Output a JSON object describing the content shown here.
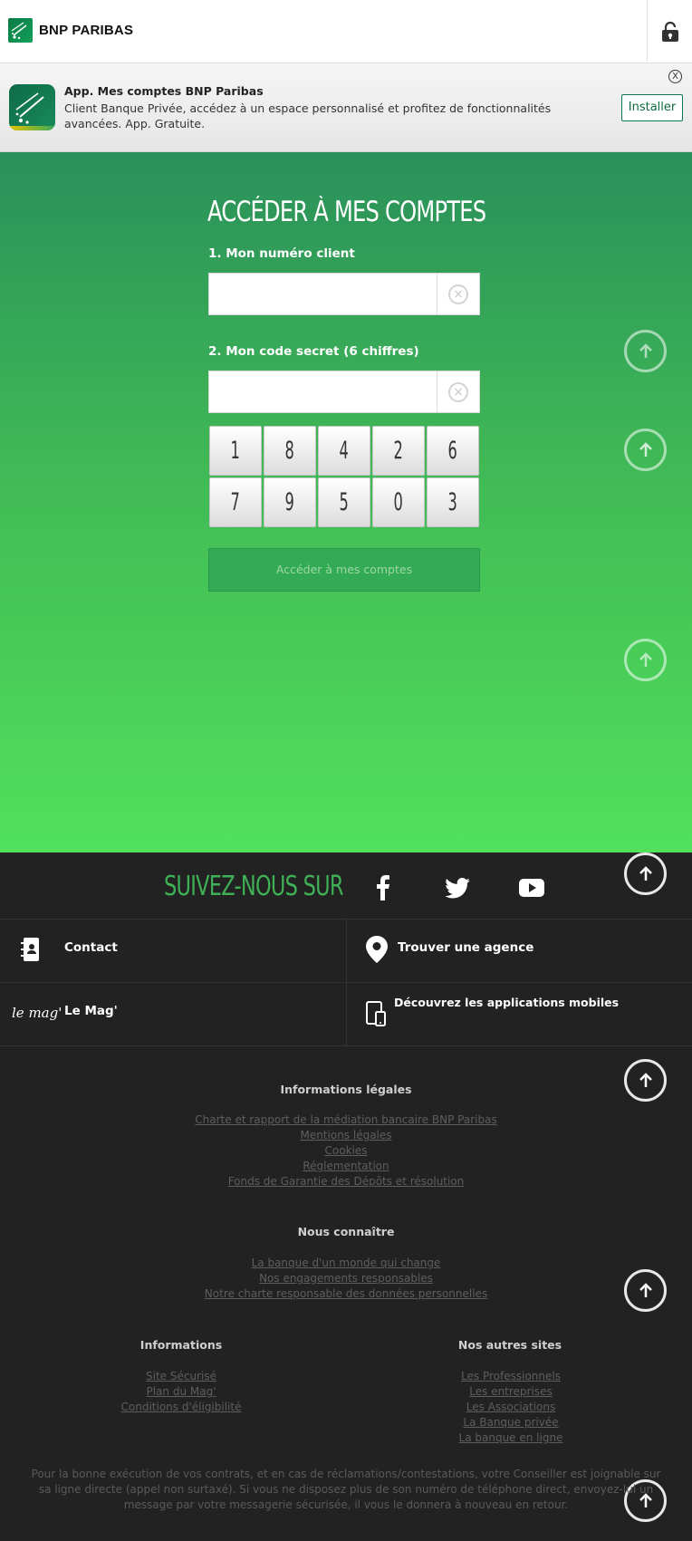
{
  "header": {
    "logo_text": "BNP PARIBAS",
    "lock_icon": "lock-icon"
  },
  "banner": {
    "close_label": "X",
    "title": "App. Mes comptes BNP Paribas",
    "description": "Client Banque Privée, accédez à un espace personnalisé et profitez de fonctionnalités avancées. App. Gratuite.",
    "install_label": "Installer"
  },
  "login": {
    "title": "ACCÉDER À MES COMPTES",
    "client_label": "1. Mon numéro client",
    "client_value": "",
    "code_label": "2. Mon code secret (6 chiffres)",
    "code_value": "",
    "keypad": [
      "1",
      "8",
      "4",
      "2",
      "6",
      "7",
      "9",
      "5",
      "0",
      "3"
    ],
    "submit_label": "Accéder à mes comptes"
  },
  "footer": {
    "follow_title": "SUIVEZ-NOUS SUR",
    "social": [
      "facebook-icon",
      "twitter-icon",
      "youtube-icon"
    ],
    "contact_label": "Contact",
    "agence_label": "Trouver une agence",
    "mag_label": "Le Mag'",
    "apps_label": "Découvrez les applications mobiles",
    "mag_logo": "le mag'",
    "legal": {
      "title": "Informations légales",
      "links": [
        "Charte et rapport de la médiation bancaire BNP Paribas",
        "Mentions légales",
        "Cookies",
        "Réglementation",
        "Fonds de Garantie des Dépôts et résolution"
      ]
    },
    "about": {
      "title": "Nous connaître",
      "links": [
        "La banque d'un monde qui change",
        "Nos engagements responsables",
        "Notre charte responsable des données personnelles"
      ]
    },
    "info": {
      "title": "Informations",
      "links": [
        "Site Sécurisé",
        "Plan du Mag'",
        "Conditions d'éligibilité"
      ]
    },
    "other_sites": {
      "title": "Nos autres sites",
      "links": [
        "Les Professionnels",
        "Les entreprises",
        "Les Associations",
        "La Banque privée",
        "La banque en ligne"
      ]
    },
    "disclaimer": "Pour la bonne exécution de vos contrats, et en cas de réclamations/contestations, votre Conseiller est joignable sur sa ligne directe (appel non surtaxé). Si vous ne disposez plus de son numéro de téléphone direct, envoyez-lui un message par votre messagerie sécurisée, il vous le donnera à nouveau en retour."
  },
  "colors": {
    "brand_green": "#0d7a4b",
    "gradient_top": "#2a905a",
    "gradient_bottom": "#51e15b",
    "footer_bg": "#222222",
    "follow_green": "#3fb055"
  }
}
